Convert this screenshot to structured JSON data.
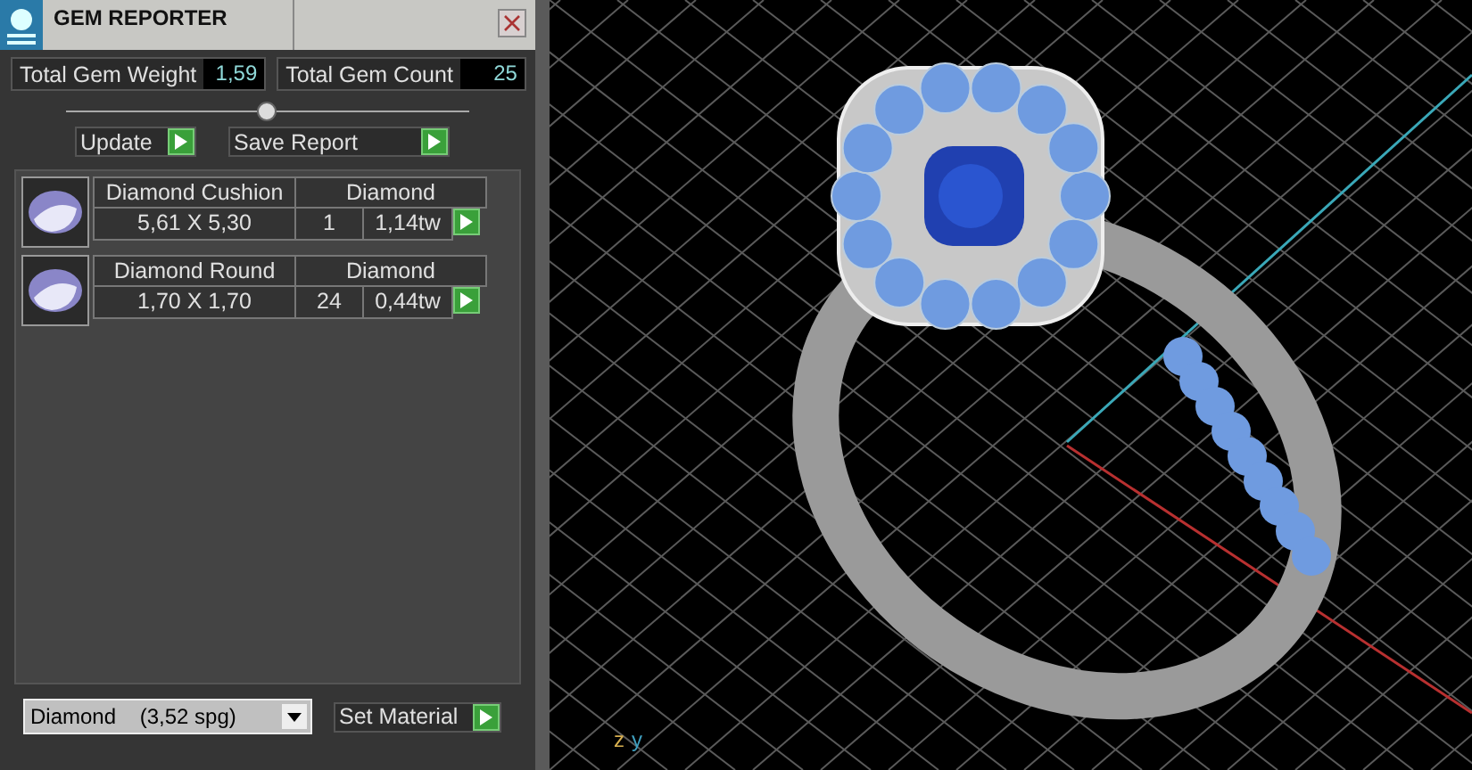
{
  "window": {
    "title": "GEM REPORTER"
  },
  "totals": [
    {
      "label": "Total Gem Weight",
      "value": "1,59"
    },
    {
      "label": "Total Gem Count",
      "value": "25"
    }
  ],
  "actions": [
    {
      "label": "Update"
    },
    {
      "label": "Save Report"
    }
  ],
  "gems": [
    {
      "name": "Diamond Cushion",
      "material": "Diamond",
      "size": "5,61 X 5,30",
      "count": "1",
      "weight": "1,14tw"
    },
    {
      "name": "Diamond Round",
      "material": "Diamond",
      "size": "1,70 X 1,70",
      "count": "24",
      "weight": "0,44tw"
    }
  ],
  "material_select": {
    "value": "Diamond    (3,52 spg)"
  },
  "set_material": {
    "label": "Set Material"
  },
  "viewport": {
    "axis_labels": [
      "z",
      "y"
    ]
  }
}
